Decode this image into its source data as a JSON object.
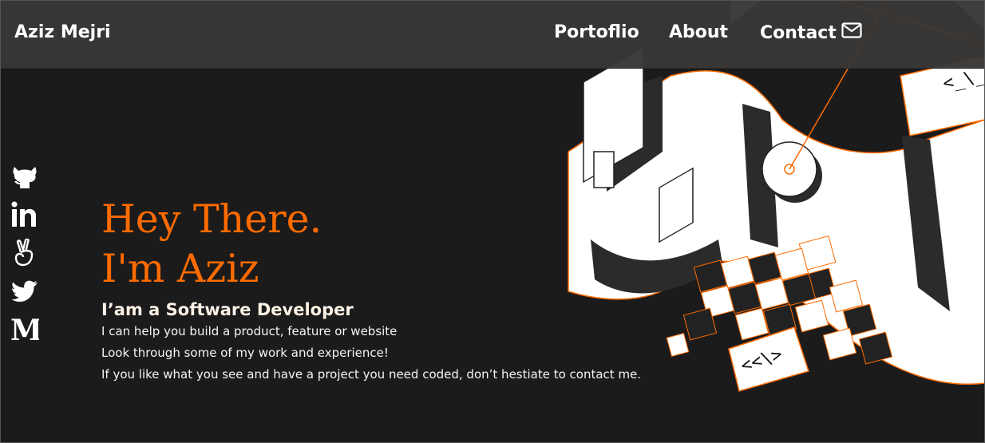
{
  "header": {
    "brand": "Aziz Mejri",
    "nav": [
      "Portoflio",
      "About",
      "Contact"
    ]
  },
  "socials": [
    {
      "name": "github",
      "icon": "github-icon"
    },
    {
      "name": "linkedin",
      "icon": "linkedin-icon"
    },
    {
      "name": "angellist",
      "icon": "angellist-icon"
    },
    {
      "name": "twitter",
      "icon": "twitter-icon"
    },
    {
      "name": "medium",
      "icon": "medium-icon"
    }
  ],
  "hero": {
    "greeting_line1": "Hey There.",
    "greeting_line2": "I'm Aziz",
    "subtitle": "I’am a Software Developer",
    "lines": [
      "I can help you build a product, feature or website",
      "Look through some of my work and experience!",
      "If you like what you see and have a project you need coded, don’t hestiate to contact me."
    ]
  },
  "illustration": {
    "code_tag_top": "<_\\_",
    "code_tag_bottom": "<<\\>"
  },
  "colors": {
    "accent": "#ff6b00",
    "background": "#1c1b1b",
    "navbar": "#3a3837",
    "text": "#ffffff"
  }
}
